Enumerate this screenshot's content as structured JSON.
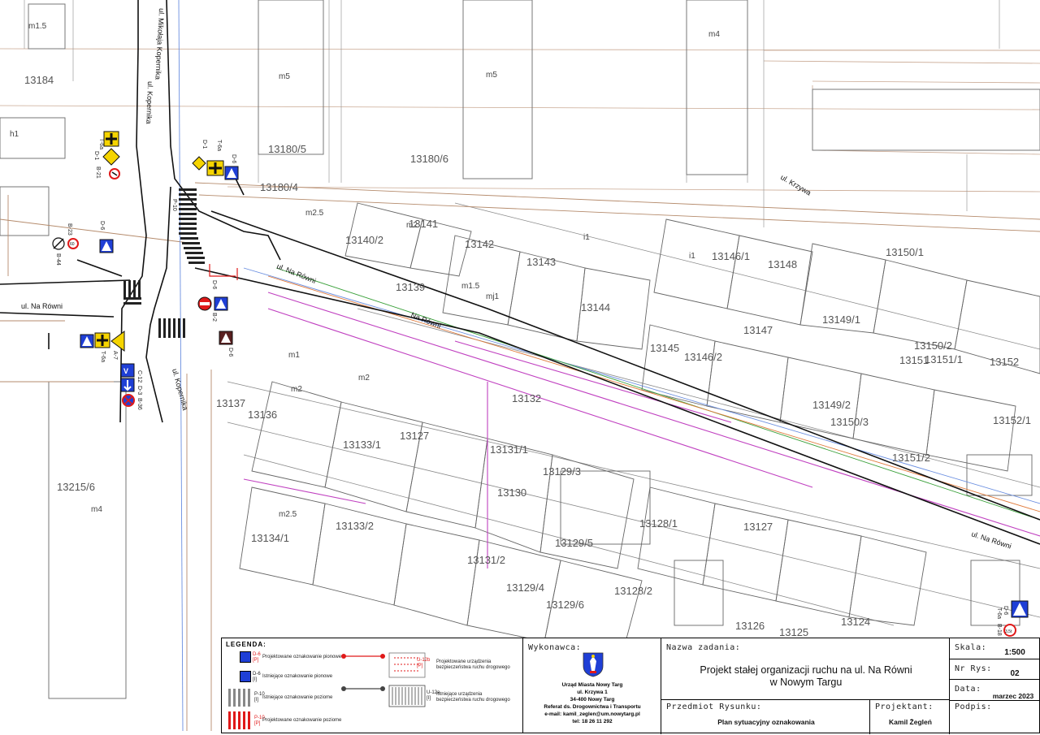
{
  "map": {
    "streets": [
      "ul. Kopernika",
      "ul. Na Równi",
      "ul. Na Równi",
      "ul. Na Równi",
      "ul. Kopernika",
      "ul. Mikołaja Kopernika",
      "Na Równi",
      "ul. Krzywa"
    ],
    "parcels": [
      "13184",
      "13180/5",
      "13180/6",
      "13180/4",
      "13140/2",
      "13141",
      "13142",
      "13143",
      "13146/1",
      "13148",
      "13150/1",
      "13139",
      "13144",
      "13145",
      "13146/2",
      "13147",
      "13149/1",
      "13150/2",
      "13151/1",
      "13152",
      "13137",
      "13136",
      "13133/1",
      "13127",
      "13132",
      "13131/1",
      "13129/3",
      "13130",
      "13149/2",
      "13150/3",
      "13151",
      "13152/1",
      "13215/6",
      "13134/1",
      "13133/2",
      "13131/2",
      "13129/4",
      "13129/5",
      "13129/6",
      "13128/1",
      "13128/2",
      "13127",
      "13126",
      "13125",
      "13124",
      "13151/2"
    ],
    "building_codes": [
      "m1.5",
      "m5",
      "m5",
      "m4",
      "h1",
      "m2",
      "i1",
      "m2.5",
      "m1",
      "m2",
      "mj1",
      "i1",
      "m1.5",
      "m2",
      "m4",
      "m2.5"
    ],
    "sign_codes": [
      "D-1",
      "T-6a",
      "D-1",
      "T-6a",
      "D-6",
      "B-21",
      "B-44",
      "B-23",
      "D-6",
      "B-2",
      "D-6",
      "D-6",
      "A-7",
      "T-6a",
      "B-36",
      "C-12",
      "D-3",
      "D-6",
      "B-18",
      "T-6a",
      "P-10"
    ]
  },
  "legend": {
    "title": "LEGENDA:",
    "items": [
      {
        "code": "D-6",
        "sub": "[P]",
        "text": "Projektowane oznakowanie pionowe"
      },
      {
        "code": "D-6",
        "sub": "[I]",
        "text": "Istniejące oznakowanie pionowe"
      },
      {
        "code": "P-10",
        "sub": "[I]",
        "text": "Istniejące oznakowanie poziome"
      },
      {
        "code": "P-10",
        "sub": "[P]",
        "text": "Projektowane oznakowanie poziome"
      }
    ],
    "devices": [
      {
        "code": "U-12b",
        "sub": "[P]",
        "text": "Projektowane urządzenia bezpieczeństwa ruchu drogowego"
      },
      {
        "code": "U-12a",
        "sub": "[I]",
        "text": "Istniejące urządzenia bezpieczeństwa ruchu drogowego"
      }
    ]
  },
  "title_block": {
    "contractor_label": "Wykonawca:",
    "emblem_text": "NOWY TARG",
    "contractor_lines": [
      "Urząd Miasta Nowy Targ",
      "ul. Krzywa 1",
      "34-400 Nowy Targ",
      "Referat ds. Drogownictwa i Transportu",
      "e-mail: kamil_zeglen@um.nowytarg.pl",
      "tel: 18 26 11 292"
    ],
    "task_label": "Nazwa zadania:",
    "task_lines": [
      "Projekt stałej organizacji ruchu na ul. Na Równi",
      "w Nowym Targu"
    ],
    "scale_label": "Skala:",
    "scale_value": "1:500",
    "drawing_no_label": "Nr Rys:",
    "drawing_no_value": "02",
    "date_label": "Data:",
    "date_value": "marzec 2023",
    "subject_label": "Przedmiot Rysunku:",
    "subject_value": "Plan sytuacyjny oznakowania",
    "designer_label": "Projektant:",
    "designer_value": "Kamil Żegleń",
    "signature_label": "Podpis:"
  },
  "colors": {
    "sign_blue": "#1f3fd6",
    "sign_yellow": "#f5d400",
    "sign_red": "#e01919",
    "parcel_line": "#a06a4a",
    "utility_pink": "#c040c0",
    "road_line": "#111111"
  }
}
